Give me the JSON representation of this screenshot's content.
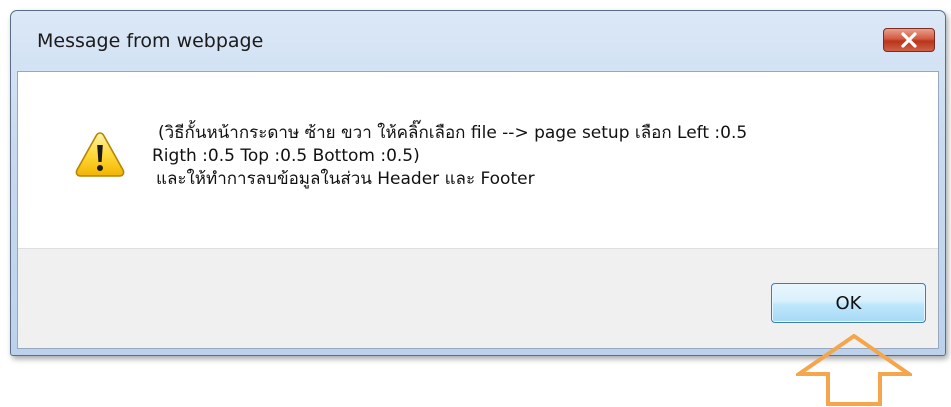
{
  "dialog": {
    "title": "Message from webpage",
    "close_icon": "close-icon",
    "message_lines": [
      "(วิธีกั้นหน้ากระดาษ ซ้าย ขวา ให้คลิ๊กเลือก file --> page setup เลือก Left :0.5",
      "Rigth :0.5 Top :0.5 Bottom :0.5)",
      "และให้ทำการลบข้อมูลในส่วน Header และ Footer"
    ],
    "icon": "warning-icon",
    "ok_label": "OK"
  },
  "annotation": {
    "icon": "up-arrow-icon",
    "color": "#f5a54c"
  }
}
